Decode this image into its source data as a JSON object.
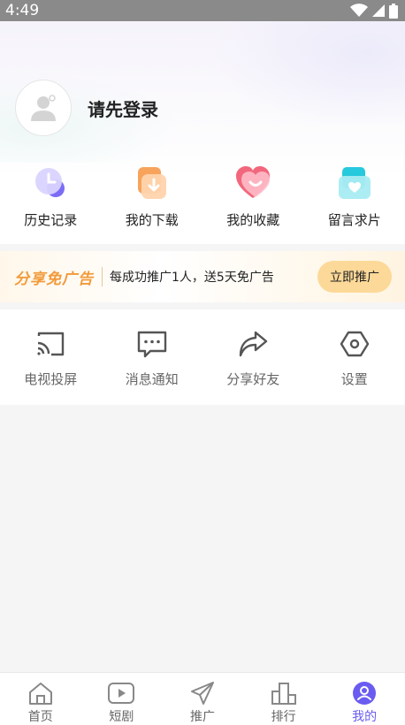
{
  "status_bar": {
    "time": "4:49"
  },
  "profile": {
    "login_prompt": "请先登录"
  },
  "quick_actions": [
    {
      "label": "历史记录",
      "icon": "history-icon"
    },
    {
      "label": "我的下载",
      "icon": "download-icon"
    },
    {
      "label": "我的收藏",
      "icon": "favorite-icon"
    },
    {
      "label": "留言求片",
      "icon": "message-request-icon"
    }
  ],
  "promo": {
    "brand": "分享免广告",
    "text": "每成功推广1人，送5天免广告",
    "button": "立即推广"
  },
  "tools": [
    {
      "label": "电视投屏",
      "icon": "cast-icon"
    },
    {
      "label": "消息通知",
      "icon": "message-icon"
    },
    {
      "label": "分享好友",
      "icon": "share-icon"
    },
    {
      "label": "设置",
      "icon": "settings-icon"
    }
  ],
  "tabbar": [
    {
      "label": "首页",
      "icon": "home-icon"
    },
    {
      "label": "短剧",
      "icon": "play-icon"
    },
    {
      "label": "推广",
      "icon": "send-icon"
    },
    {
      "label": "排行",
      "icon": "ranking-icon"
    },
    {
      "label": "我的",
      "icon": "user-icon",
      "active": true
    }
  ],
  "colors": {
    "accent": "#6a5cf0",
    "promo_button": "#fcd998",
    "promo_brand": "#f29a3a"
  }
}
